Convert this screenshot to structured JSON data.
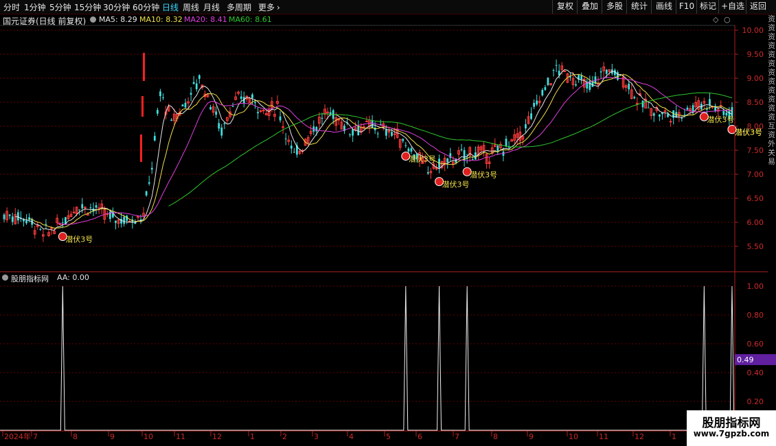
{
  "toolbar": {
    "tabs": [
      {
        "label": "分时",
        "active": false
      },
      {
        "label": "1分钟",
        "active": false
      },
      {
        "label": "5分钟",
        "active": false
      },
      {
        "label": "15分钟",
        "active": false
      },
      {
        "label": "30分钟",
        "active": false
      },
      {
        "label": "60分钟",
        "active": false
      },
      {
        "label": "日线",
        "active": true
      },
      {
        "label": "周线",
        "active": false
      },
      {
        "label": "月线",
        "active": false
      },
      {
        "label": "多周期",
        "active": false
      },
      {
        "label": "更多",
        "active": false
      }
    ],
    "more_chevron": "›",
    "right_buttons": [
      "复权",
      "叠加",
      "多股",
      "统计",
      "画线",
      "F10",
      "标记",
      "+自选",
      "返回"
    ]
  },
  "main_chart": {
    "stock_title": "国元证券",
    "period_label": "(日线 前复权)",
    "indicators": [
      {
        "label": "MA5: 8.29",
        "color": "#e8e8e8"
      },
      {
        "label": "MA10: 8.32",
        "color": "#f0e14a"
      },
      {
        "label": "MA20: 8.41",
        "color": "#e040e0"
      },
      {
        "label": "MA60: 8.61",
        "color": "#2ec82e"
      }
    ],
    "y_ticks": [
      "10.00",
      "9.50",
      "9.00",
      "8.50",
      "8.00",
      "7.50",
      "7.00",
      "6.50",
      "6.00",
      "5.50"
    ],
    "signal_label": "潜伏3号",
    "signals": [
      {
        "label": "潜伏3号",
        "x_date": "2024-07-29"
      },
      {
        "label": "潜伏3号",
        "x_date": "2025-05-06"
      },
      {
        "label": "潜伏3号",
        "x_date": "2025-06-03"
      },
      {
        "label": "潜伏3号",
        "x_date": "2025-06-25"
      },
      {
        "label": "潜伏3号",
        "x_date": "2026-01-05"
      },
      {
        "label": "潜伏3号",
        "x_date": "2026-01-28"
      },
      {
        "label": "潜伏3号",
        "x_date": "2026-02-02"
      }
    ],
    "colors": {
      "up": "#ff3c3c",
      "down": "#40e0e0",
      "grid": "#6a0000"
    }
  },
  "sub_chart": {
    "title": "股朋指标网",
    "aa_label": "AA: 0.00",
    "y_ticks": [
      "1.00",
      "0.80",
      "0.60",
      "0.40",
      "0.20"
    ],
    "current_value": "0.49"
  },
  "x_axis": {
    "labels": [
      "2024年",
      "7",
      "8",
      "9",
      "10",
      "11",
      "12",
      "1",
      "2",
      "3",
      "4",
      "5",
      "6",
      "7",
      "8",
      "9",
      "10",
      "11",
      "12",
      "1"
    ]
  },
  "right_strip_text": "资资资资资资资资资资资资互资外关 易",
  "watermark": {
    "line1": "股朋指标网",
    "line2": "www.7gpzb.com"
  }
}
